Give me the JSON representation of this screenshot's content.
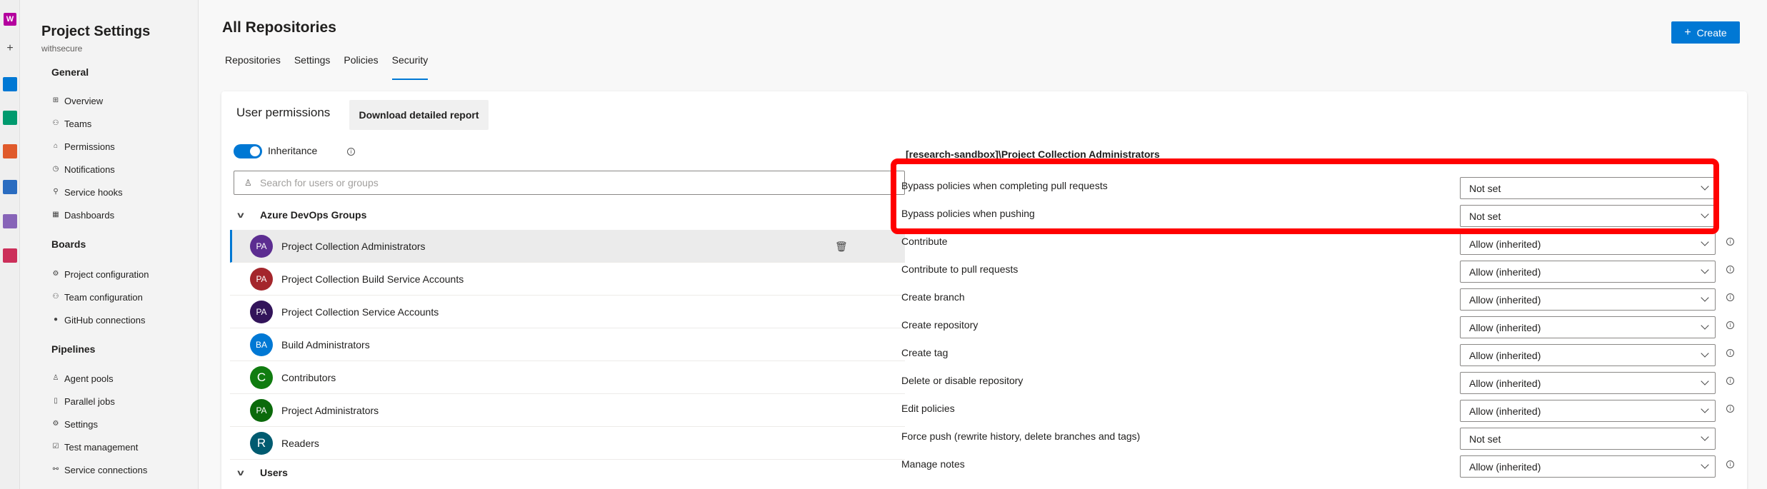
{
  "org_initial": "W",
  "nav": {
    "title": "Project Settings",
    "subtitle": "withsecure",
    "sections": {
      "general": "General",
      "boards": "Boards",
      "pipelines": "Pipelines"
    },
    "general_items": [
      "Overview",
      "Teams",
      "Permissions",
      "Notifications",
      "Service hooks",
      "Dashboards"
    ],
    "boards_items": [
      "Project configuration",
      "Team configuration",
      "GitHub connections"
    ],
    "pipelines_items": [
      "Agent pools",
      "Parallel jobs",
      "Settings",
      "Test management",
      "Service connections"
    ]
  },
  "header": {
    "title": "All Repositories",
    "create_label": "Create",
    "tabs": [
      "Repositories",
      "Settings",
      "Policies",
      "Security"
    ],
    "active_tab": "Security"
  },
  "left": {
    "user_permissions": "User permissions",
    "download_label": "Download detailed report",
    "inheritance_label": "Inheritance",
    "search_placeholder": "Search for users or groups",
    "group_header": "Azure DevOps Groups",
    "users_header": "Users",
    "groups": [
      {
        "initials": "PA",
        "name": "Project Collection Administrators",
        "color": "#5c2d91",
        "selected": true
      },
      {
        "initials": "PA",
        "name": "Project Collection Build Service Accounts",
        "color": "#a4262c"
      },
      {
        "initials": "PA",
        "name": "Project Collection Service Accounts",
        "color": "#32145a"
      },
      {
        "initials": "BA",
        "name": "Build Administrators",
        "color": "#0078d4"
      },
      {
        "initials": "C",
        "name": "Contributors",
        "color": "#107c10"
      },
      {
        "initials": "PA",
        "name": "Project Administrators",
        "color": "#0b6a0b"
      },
      {
        "initials": "R",
        "name": "Readers",
        "color": "#005b70"
      }
    ]
  },
  "permissions": {
    "group_title": "[research-sandbox]\\Project Collection Administrators",
    "rows": [
      {
        "label": "Bypass policies when completing pull requests",
        "value": "Not set",
        "info": false
      },
      {
        "label": "Bypass policies when pushing",
        "value": "Not set",
        "info": false
      },
      {
        "label": "Contribute",
        "value": "Allow (inherited)",
        "info": true
      },
      {
        "label": "Contribute to pull requests",
        "value": "Allow (inherited)",
        "info": true
      },
      {
        "label": "Create branch",
        "value": "Allow (inherited)",
        "info": true
      },
      {
        "label": "Create repository",
        "value": "Allow (inherited)",
        "info": true
      },
      {
        "label": "Create tag",
        "value": "Allow (inherited)",
        "info": true
      },
      {
        "label": "Delete or disable repository",
        "value": "Allow (inherited)",
        "info": true
      },
      {
        "label": "Edit policies",
        "value": "Allow (inherited)",
        "info": true
      },
      {
        "label": "Force push (rewrite history, delete branches and tags)",
        "value": "Not set",
        "info": false
      },
      {
        "label": "Manage notes",
        "value": "Allow (inherited)",
        "info": true
      }
    ]
  },
  "colors": {
    "accent": "#0078d4",
    "highlight": "#ff0000"
  }
}
